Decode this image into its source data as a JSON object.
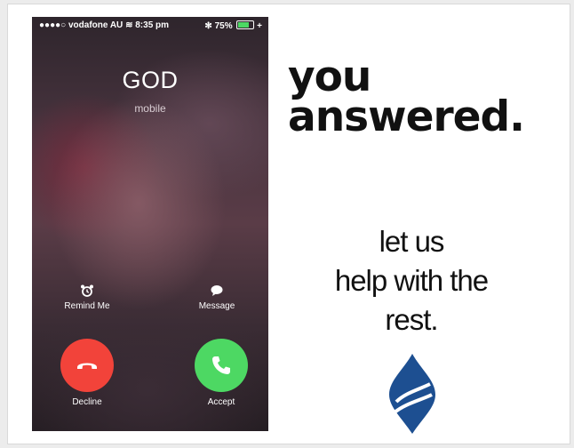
{
  "status_bar": {
    "carrier": "●●●●○ vodafone AU",
    "wifi": "≋",
    "time": "8:35 pm",
    "bluetooth": "✻",
    "battery_percent": "75%",
    "battery_level": 0.75,
    "charging": "+"
  },
  "call": {
    "caller_name": "GOD",
    "caller_label": "mobile",
    "remind_label": "Remind Me",
    "message_label": "Message",
    "decline_label": "Decline",
    "accept_label": "Accept"
  },
  "ad": {
    "headline_line1": "you",
    "headline_line2": "answered.",
    "sub_line1": "let us",
    "sub_line2": "help with the",
    "sub_line3": "rest."
  },
  "colors": {
    "decline": "#f2433a",
    "accept": "#4dd863",
    "logo": "#1d4f91"
  },
  "icons": [
    "alarm-clock-icon",
    "speech-bubble-icon",
    "hang-up-icon",
    "phone-icon",
    "flame-logo"
  ]
}
